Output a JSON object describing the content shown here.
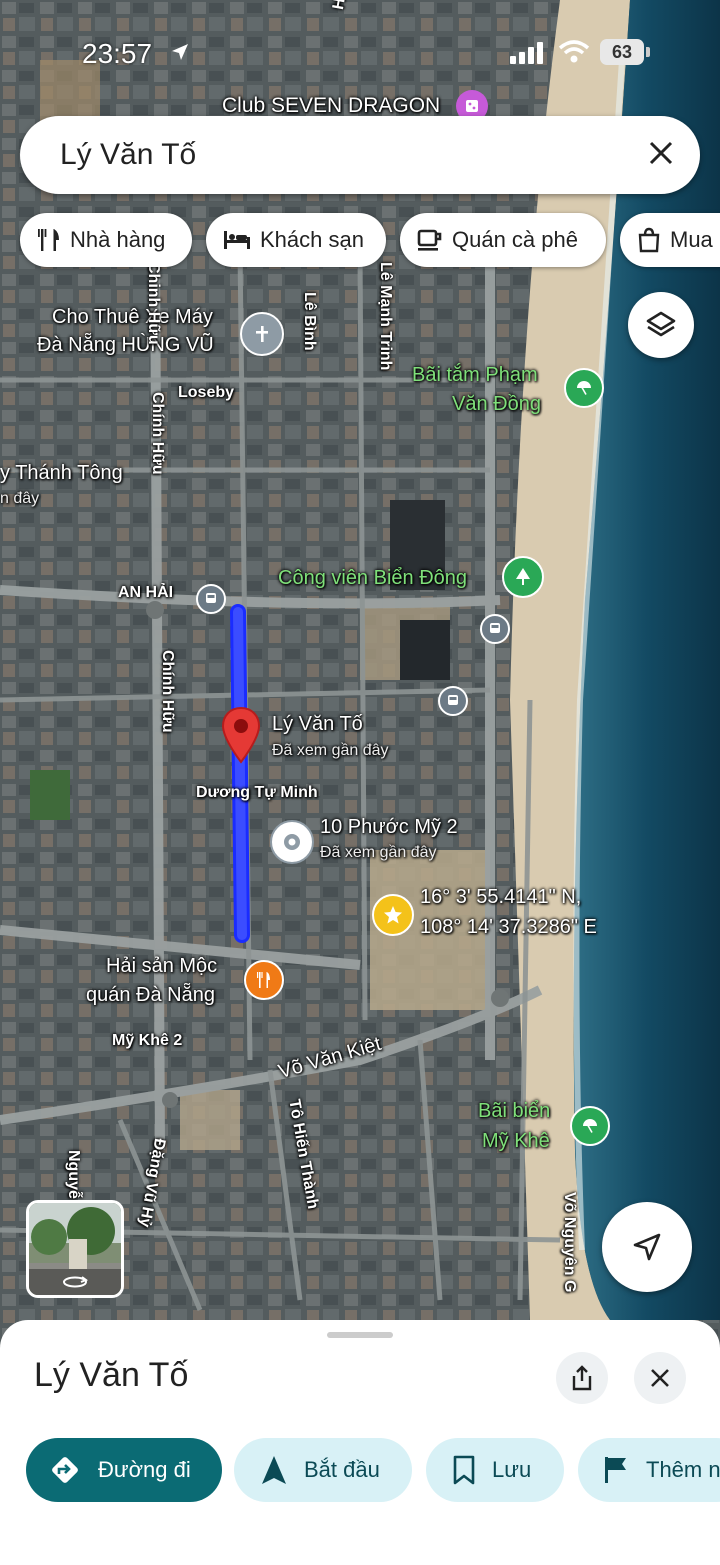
{
  "status": {
    "time": "23:57",
    "battery": "63"
  },
  "search": {
    "query": "Lý Văn Tố"
  },
  "chips": [
    {
      "icon": "restaurant-icon",
      "label": "Nhà hàng"
    },
    {
      "icon": "hotel-icon",
      "label": "Khách sạn"
    },
    {
      "icon": "coffee-icon",
      "label": "Quán cà phê"
    },
    {
      "icon": "shopping-icon",
      "label": "Mua"
    }
  ],
  "map": {
    "top_poi": "Club SEVEN DRAGON",
    "streets": {
      "ho_nghinh": "Hồ Nghi",
      "le_binh": "Lê Bình",
      "le_manh_trinh": "Lê Mạnh Trinh",
      "chinh_huu_1": "Chinh Hữu",
      "chinh_huu_2": "Chính Hữu",
      "chinh_huu_3": "Chính Hữu",
      "thanh_tong": "y Thánh Tông",
      "an_hai": "AN HẢI",
      "duong_tu_minh": "Dương Tự Minh",
      "my_khe_2": "Mỹ Khê 2",
      "vo_van_kiet": "Võ Văn Kiệt",
      "to_hien_thanh": "Tô Hiến Thành",
      "dang_vu_hy": "Đặng Vũ Hỷ",
      "nguyen": "Nguyễ",
      "vo_nguyen_giap": "Võ Nguyên G",
      "loseby": "Loseby",
      "near_here": "n đây"
    },
    "pois": {
      "rental_1": "Cho Thuê Xe Máy",
      "rental_2": "Đà Nẵng HÙNG VŨ",
      "beach_pvd_1": "Bãi tắm Phạm",
      "beach_pvd_2": "Văn Đồng",
      "park": "Công viên Biển Đông",
      "pin_title": "Lý Văn Tố",
      "pin_sub": "Đã xem gần đây",
      "place2_title": "10 Phước Mỹ 2",
      "place2_sub": "Đã xem gần đây",
      "coord_lat": "16° 3' 55.4141\" N,",
      "coord_lng": "108° 14' 37.3286\" E",
      "seafood_1": "Hải sản Mộc",
      "seafood_2": "quán Đà Nẵng",
      "beach_mk_1": "Bãi biển",
      "beach_mk_2": "Mỹ Khê"
    },
    "route_color": "#1a2cff",
    "pin_color": "#e53935"
  },
  "sheet": {
    "title": "Lý Văn Tố",
    "actions": [
      {
        "icon": "directions-icon",
        "label": "Đường đi"
      },
      {
        "icon": "navigation-arrow-icon",
        "label": "Bắt đầu"
      },
      {
        "icon": "bookmark-icon",
        "label": "Lưu"
      },
      {
        "icon": "flag-icon",
        "label": "Thêm n"
      }
    ]
  }
}
